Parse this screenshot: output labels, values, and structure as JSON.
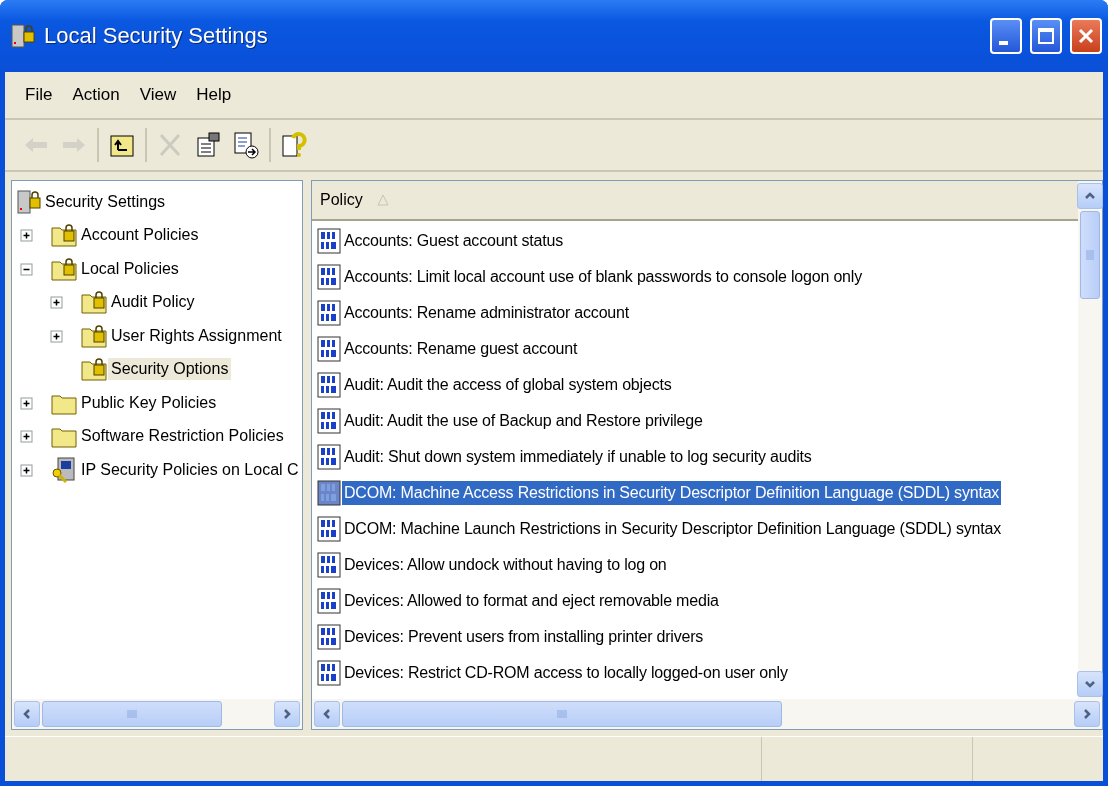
{
  "window": {
    "title": "Local Security Settings"
  },
  "menu": [
    "File",
    "Action",
    "View",
    "Help"
  ],
  "toolbar": [
    {
      "kind": "back",
      "disabled": true
    },
    {
      "kind": "forward",
      "disabled": true
    },
    {
      "kind": "separator"
    },
    {
      "kind": "up",
      "disabled": false
    },
    {
      "kind": "separator"
    },
    {
      "kind": "delete",
      "disabled": true
    },
    {
      "kind": "properties",
      "disabled": false
    },
    {
      "kind": "export",
      "disabled": false
    },
    {
      "kind": "separator"
    },
    {
      "kind": "help",
      "disabled": false
    }
  ],
  "tree": [
    {
      "label": "Security Settings",
      "kind": "server-lock",
      "selected": false,
      "children": [
        {
          "label": "Account Policies",
          "kind": "folder-lock",
          "expanded": false,
          "selected": false
        },
        {
          "label": "Local Policies",
          "kind": "folder-lock",
          "expanded": true,
          "selected": false,
          "children": [
            {
              "label": "Audit Policy",
              "kind": "folder-lock",
              "expanded": false,
              "selected": false
            },
            {
              "label": "User Rights Assignment",
              "kind": "folder-lock",
              "expanded": false,
              "selected": false
            },
            {
              "label": "Security Options",
              "kind": "folder-lock",
              "selected": true
            }
          ]
        },
        {
          "label": "Public Key Policies",
          "kind": "folder",
          "expanded": false,
          "selected": false
        },
        {
          "label": "Software Restriction Policies",
          "kind": "folder",
          "expanded": false,
          "selected": false
        },
        {
          "label": "IP Security Policies on Local C",
          "kind": "computer-key",
          "expanded": false,
          "selected": false
        }
      ]
    }
  ],
  "list": {
    "columns": [
      "Policy"
    ],
    "rows": [
      {
        "policy": "Accounts: Guest account status",
        "selected": false
      },
      {
        "policy": "Accounts: Limit local account use of blank passwords to console logon only",
        "selected": false
      },
      {
        "policy": "Accounts: Rename administrator account",
        "selected": false
      },
      {
        "policy": "Accounts: Rename guest account",
        "selected": false
      },
      {
        "policy": "Audit: Audit the access of global system objects",
        "selected": false
      },
      {
        "policy": "Audit: Audit the use of Backup and Restore privilege",
        "selected": false
      },
      {
        "policy": "Audit: Shut down system immediately if unable to log security audits",
        "selected": false
      },
      {
        "policy": "DCOM: Machine Access Restrictions in Security Descriptor Definition Language (SDDL) syntax",
        "selected": true
      },
      {
        "policy": "DCOM: Machine Launch Restrictions in Security Descriptor Definition Language (SDDL) syntax",
        "selected": false
      },
      {
        "policy": "Devices: Allow undock without having to log on",
        "selected": false
      },
      {
        "policy": "Devices: Allowed to format and eject removable media",
        "selected": false
      },
      {
        "policy": "Devices: Prevent users from installing printer drivers",
        "selected": false
      },
      {
        "policy": "Devices: Restrict CD-ROM access to locally logged-on user only",
        "selected": false
      }
    ]
  }
}
